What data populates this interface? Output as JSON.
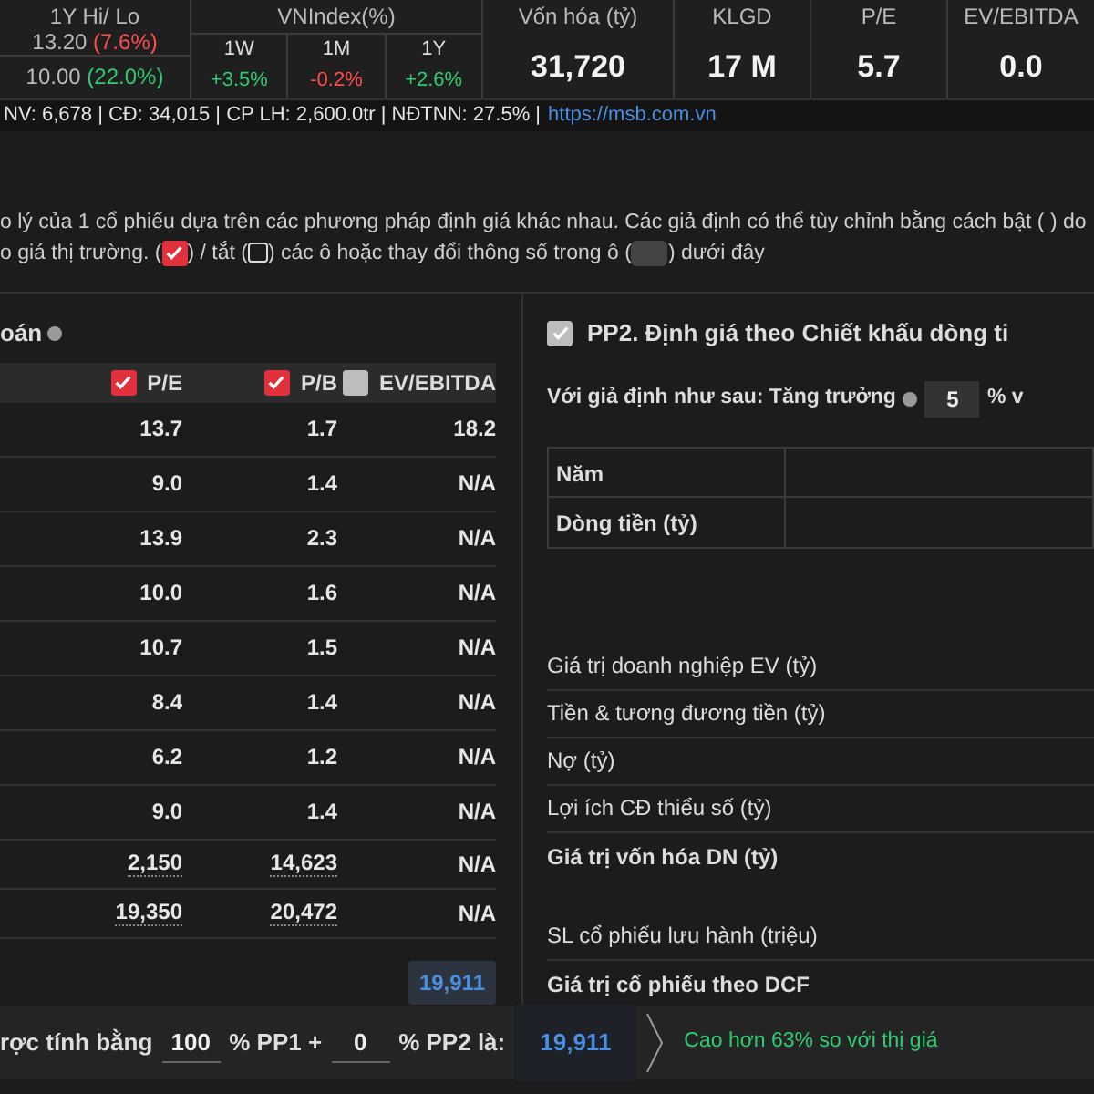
{
  "stats": {
    "hilo": {
      "label": "1Y Hi/ Lo",
      "high": "13.20",
      "high_change": "(7.6%)",
      "low": "10.00",
      "low_change": "(22.0%)"
    },
    "vnindex": {
      "label": "VNIndex(%)",
      "periods": [
        {
          "label": "1W",
          "value": "+3.5%",
          "positive": true
        },
        {
          "label": "1M",
          "value": "-0.2%",
          "positive": false
        },
        {
          "label": "1Y",
          "value": "+2.6%",
          "positive": true
        }
      ]
    },
    "metrics": [
      {
        "label": "Vốn hóa (tỷ)",
        "value": "31,720"
      },
      {
        "label": "KLGD",
        "value": "17 M"
      },
      {
        "label": "P/E",
        "value": "5.7"
      },
      {
        "label": "EV/EBITDA",
        "value": "0.0"
      }
    ]
  },
  "info_line": {
    "text": "NV: 6,678 | CĐ: 34,015 | CP LH: 2,600.0tr | NĐTNN:  27.5% |",
    "link": "https://msb.com.vn"
  },
  "intro": {
    "line_1": "o lý của 1 cổ phiếu dựa trên các phương pháp định giá khác nhau. Các giả định có thể tùy chỉnh bằng cách bật ( ) do",
    "line_2_before_on": "o giá thị trường. (",
    "line_2_before_off": ") / tắt (",
    "line_2_before_field": ") các ô hoặc thay đổi thông số trong ô (",
    "line_2_end": ") dưới đây"
  },
  "pp1": {
    "title": "oán",
    "columns": [
      {
        "label": "P/E",
        "checked": true,
        "disabled": false
      },
      {
        "label": "P/B",
        "checked": true,
        "disabled": false
      },
      {
        "label": "EV/EBITDA",
        "checked": false,
        "disabled": true
      }
    ],
    "rows": [
      {
        "cells": [
          "13.7",
          "1.7",
          "18.2"
        ],
        "dotted": false
      },
      {
        "cells": [
          "9.0",
          "1.4",
          "N/A"
        ],
        "dotted": false
      },
      {
        "cells": [
          "13.9",
          "2.3",
          "N/A"
        ],
        "dotted": false
      },
      {
        "cells": [
          "10.0",
          "1.6",
          "N/A"
        ],
        "dotted": false
      },
      {
        "cells": [
          "10.7",
          "1.5",
          "N/A"
        ],
        "dotted": false
      },
      {
        "cells": [
          "8.4",
          "1.4",
          "N/A"
        ],
        "dotted": false
      },
      {
        "cells": [
          "6.2",
          "1.2",
          "N/A"
        ],
        "dotted": false
      },
      {
        "cells": [
          "9.0",
          "1.4",
          "N/A"
        ],
        "dotted": false
      },
      {
        "cells": [
          "2,150",
          "14,623",
          "N/A"
        ],
        "dotted": true
      },
      {
        "cells": [
          "19,350",
          "20,472",
          "N/A"
        ],
        "dotted": true
      }
    ],
    "total": "19,911"
  },
  "pp2": {
    "title": "PP2. Định giá theo Chiết khấu dòng ti",
    "checked": true,
    "disabled": true,
    "assumption": "Với giả định như sau: Tăng trưởng",
    "growth": "5",
    "after_growth": "% v",
    "table_rows": [
      "Năm",
      "Dòng tiền (tỷ)"
    ],
    "groups": [
      [
        "Giá trị doanh nghiệp EV (tỷ)",
        "Tiền & tương đương tiền (tỷ)",
        "Nợ (tỷ)",
        "Lợi ích CĐ thiểu số (tỷ)",
        "Giá trị vốn hóa DN (tỷ)"
      ],
      [
        "SL cổ phiếu lưu hành (triệu)",
        "Giá trị cổ phiếu theo DCF"
      ]
    ]
  },
  "summary": {
    "prefix": "rợc tính bằng",
    "pp1_weight": "100",
    "pp1_label": "% PP1 +",
    "pp2_weight": "0",
    "pp2_label": "% PP2 là:",
    "value": "19,911",
    "verdict": "Cao hơn 63% so với thị giá"
  }
}
